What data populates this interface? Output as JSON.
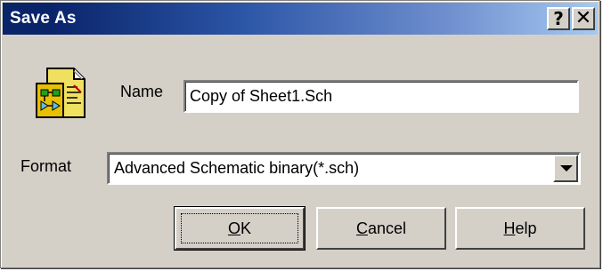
{
  "window": {
    "title": "Save As",
    "help_glyph": "?",
    "close_glyph": "✕"
  },
  "icons": {
    "app": "schematic-document-icon",
    "dropdown": "dropdown-arrow-icon"
  },
  "form": {
    "name_label": "Name",
    "name_value": "Copy of Sheet1.Sch",
    "format_label": "Format",
    "format_value": "Advanced Schematic binary(*.sch)"
  },
  "buttons": {
    "ok": {
      "mnemonic": "O",
      "rest": "K"
    },
    "cancel": {
      "mnemonic": "C",
      "rest": "ancel"
    },
    "help": {
      "mnemonic": "H",
      "rest": "elp"
    }
  },
  "colors": {
    "titlebar_start": "#0a246a",
    "titlebar_end": "#a6caf0",
    "dialog_face": "#d4d0c8"
  }
}
